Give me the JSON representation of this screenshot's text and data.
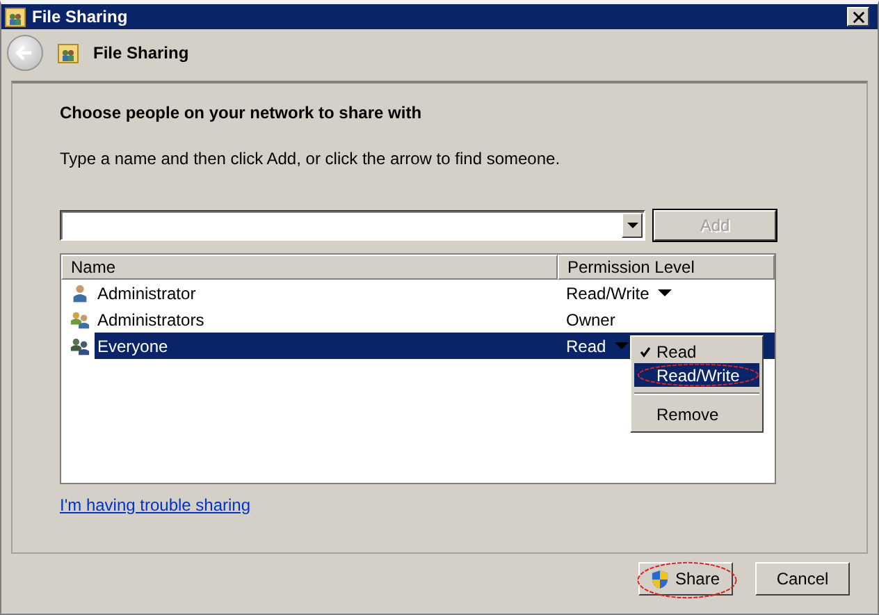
{
  "window": {
    "title": "File Sharing"
  },
  "header": {
    "title": "File Sharing"
  },
  "heading": "Choose people on your network to share with",
  "instruction": "Type a name and then click Add, or click the arrow to find someone.",
  "add_button": {
    "label": "Add",
    "disabled": true
  },
  "table": {
    "columns": [
      "Name",
      "Permission Level"
    ],
    "rows": [
      {
        "kind": "user",
        "name": "Administrator",
        "permission": "Read/Write",
        "dropdown": true,
        "selected": false
      },
      {
        "kind": "group",
        "name": "Administrators",
        "permission": "Owner",
        "dropdown": false,
        "selected": false
      },
      {
        "kind": "everyone",
        "name": "Everyone",
        "permission": "Read",
        "dropdown": true,
        "selected": true
      }
    ]
  },
  "permission_menu": {
    "items": [
      {
        "kind": "option",
        "label": "Read",
        "checked": true,
        "selected": false,
        "circled": false
      },
      {
        "kind": "option",
        "label": "Read/Write",
        "checked": false,
        "selected": true,
        "circled": true
      },
      {
        "kind": "separator"
      },
      {
        "kind": "option",
        "label": "Remove",
        "checked": false,
        "selected": false,
        "circled": false
      }
    ]
  },
  "trouble_link": "I'm having trouble sharing",
  "buttons": [
    {
      "kind": "shield",
      "label": "Share",
      "circled": true
    },
    {
      "kind": "plain",
      "label": "Cancel",
      "circled": false
    }
  ]
}
